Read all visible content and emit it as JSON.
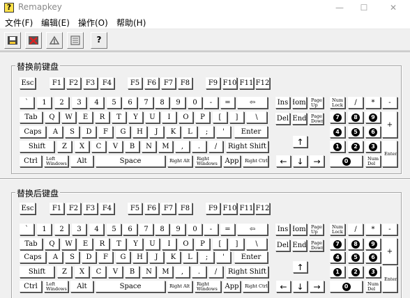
{
  "window": {
    "title": "Remapkey",
    "icon_glyph": "?",
    "minimize": "—",
    "maximize": "☐",
    "close": "✕"
  },
  "menu": [
    {
      "label": "文件(F)"
    },
    {
      "label": "编辑(E)"
    },
    {
      "label": "操作(O)"
    },
    {
      "label": "帮助(H)"
    }
  ],
  "toolbar": [
    {
      "name": "save-icon"
    },
    {
      "name": "delete-icon"
    },
    {
      "name": "remap-icon"
    },
    {
      "name": "list-icon"
    },
    {
      "name": "help-icon",
      "glyph": "?"
    }
  ],
  "panels": [
    {
      "title": "替换前键盘"
    },
    {
      "title": "替换后键盘"
    }
  ],
  "keyboard": {
    "fn": [
      "Esc",
      "F1",
      "F2",
      "F3",
      "F4",
      "F5",
      "F6",
      "F7",
      "F8",
      "F9",
      "F10",
      "F11",
      "F12"
    ],
    "num_row": [
      "`",
      "1",
      "2",
      "3",
      "4",
      "5",
      "6",
      "7",
      "8",
      "9",
      "0",
      "-",
      "=",
      "⇦"
    ],
    "tab_row": [
      "Tab",
      "Q",
      "W",
      "E",
      "R",
      "T",
      "Y",
      "U",
      "I",
      "O",
      "P",
      "[",
      "]",
      "\\"
    ],
    "caps_row": [
      "Caps",
      "A",
      "S",
      "D",
      "F",
      "G",
      "H",
      "J",
      "K",
      "L",
      ";",
      "'",
      "Enter"
    ],
    "shift_row": [
      "Shift",
      "Z",
      "X",
      "C",
      "V",
      "B",
      "N",
      "M",
      ",",
      ".",
      "/",
      "Right Shift"
    ],
    "bottom_row": [
      "Ctrl",
      "Left Windows",
      "Alt",
      "Space",
      "Right Alt",
      "Right Windows",
      "App",
      "Right Ctrl"
    ],
    "nav_top": [
      "Ins",
      "Home",
      "Page Up"
    ],
    "nav_bottom": [
      "Del",
      "End",
      "Page Down"
    ],
    "arrows": [
      "↑",
      "←",
      "↓",
      "→"
    ],
    "numpad_top": [
      "Num Lock",
      "/",
      "*",
      "-"
    ],
    "numpad_789": [
      "7",
      "8",
      "9"
    ],
    "numpad_456": [
      "4",
      "5",
      "6"
    ],
    "numpad_123": [
      "1",
      "2",
      "3"
    ],
    "numpad_plus": "+",
    "numpad_enter": "Enter",
    "numpad_0": "0",
    "numpad_del": "Num Del"
  }
}
